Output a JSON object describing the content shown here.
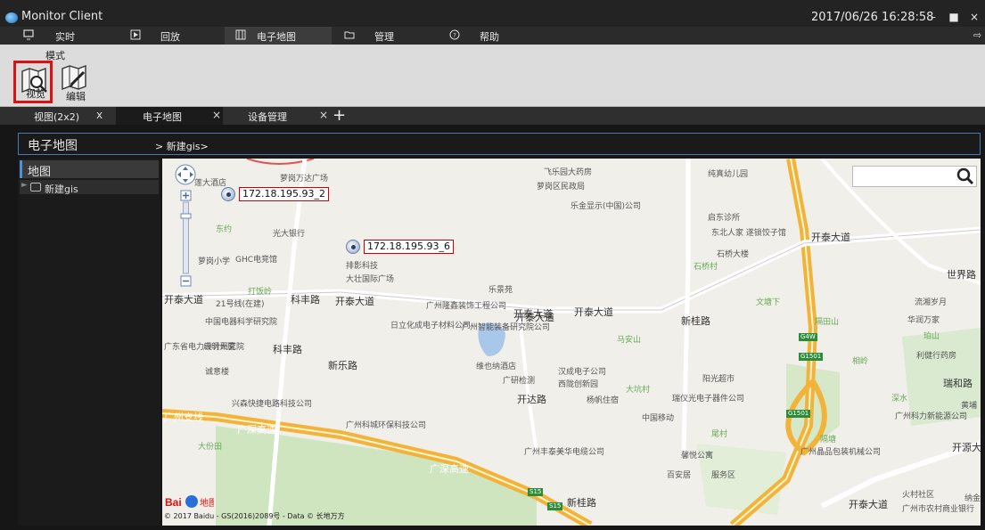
{
  "window": {
    "title": "Monitor Client",
    "clock": "2017/06/26 16:28:58"
  },
  "mainnav": {
    "tabs": [
      {
        "label": "实时",
        "icon": "monitor-icon"
      },
      {
        "label": "回放",
        "icon": "play-icon"
      },
      {
        "label": "电子地图",
        "icon": "map-icon",
        "active": true
      },
      {
        "label": "管理",
        "icon": "folder-icon"
      },
      {
        "label": "帮助",
        "icon": "help-icon"
      }
    ]
  },
  "toolbar": {
    "group_title": "模式",
    "tools": [
      {
        "label": "视览",
        "active": true
      },
      {
        "label": "编辑",
        "active": false
      }
    ]
  },
  "doctabs": {
    "tabs": [
      {
        "label": "视图(2x2)",
        "close": "x"
      },
      {
        "label": "电子地图",
        "close": "×",
        "active": true
      },
      {
        "label": "设备管理",
        "close": "×"
      }
    ],
    "add_label": "+"
  },
  "breadcrumb": {
    "title": "电子地图",
    "path": "> 新建gis>"
  },
  "sidebar": {
    "heading": "地图",
    "items": [
      {
        "label": "新建gis"
      }
    ]
  },
  "map": {
    "cameras": [
      {
        "label": "172.18.195.93_2"
      },
      {
        "label": "172.18.195.93_6"
      }
    ],
    "search": {
      "value": "",
      "placeholder": ""
    },
    "copyright": "© 2017 Baidu - GS(2016)2089号 - Data © 长地万方",
    "logo": "Bai 地图",
    "labels": {
      "l1": "萝岗万达广场",
      "l2": "莲大酒店",
      "l3": "东约",
      "l4": "光大银行",
      "l5": "GHC电竞馆",
      "l6": "萝岗小学",
      "l7": "打饭岭",
      "l8": "排影科技",
      "l9": "大壮国际广场",
      "l10": "乐景苑",
      "l11": "飞乐园大药房",
      "l12": "萝岗区民政局",
      "l13": "乐金显示(中国)公司",
      "l14": "纯真幼儿园",
      "l15": "启东诊所",
      "l16": "东北人家 遂锁饺子馆",
      "l17": "石桥大楼",
      "l18": "石桥村",
      "l19": "开泰大道",
      "l20": "开泰大道",
      "l21": "开泰大道",
      "l22": "开泰大道",
      "l23": "开泰大道",
      "l24": "21号线(在建)",
      "l25": "中国电器科学研究院",
      "l26": "启明大厦",
      "l27": "广东省电力设计研究院",
      "l28": "诚意楼",
      "l29": "日立化成电子材料公司",
      "l30": "广州智能装备研究院公司",
      "l31": "广州隆鑫装饰工程公司",
      "l32": "维也纳酒店",
      "l33": "汉成电子公司",
      "l34": "西陇创新园",
      "l35": "广研检测",
      "l36": "杨帆住宿",
      "l37": "大坑村",
      "l38": "瑞仪光电子器件公司",
      "l39": "中国移动",
      "l40": "阳光超市",
      "l41": "马安山",
      "l42": "新桂路",
      "l43": "文塘下",
      "l44": "隔田山",
      "l45": "流湘岁月",
      "l46": "华润万家",
      "l47": "珀山",
      "l48": "利健行药房",
      "l49": "相岭",
      "l50": "深水",
      "l51": "广州科力新能源公司",
      "l52": "兴森快捷电路科技公司",
      "l53": "广州科城环保科技公司",
      "l54": "广州丰泰美华电缆公司",
      "l55": "馨悦公寓",
      "l56": "百安居",
      "l57": "服务区",
      "l58": "尾村",
      "l59": "隔塘",
      "l60": "广州晶品包装机械公司",
      "l61": "火村社区",
      "l62": "广州市农村商业银行",
      "l63": "开源大",
      "l64": "广深高速",
      "l65": "广深高速",
      "l66": "广州支线",
      "l67": "大份田",
      "l68": "新桂路",
      "l69": "开达路",
      "l70": "科丰路",
      "l71": "科丰路",
      "l72": "新乐路",
      "l73": "世界路",
      "l74": "瑞和路",
      "l75": "纳金",
      "l76": "黄埔",
      "l77": "开泰大道",
      "l78": "开泰大道"
    },
    "badges": [
      "G4W",
      "G1501",
      "G1501",
      "S15",
      "S15"
    ]
  }
}
